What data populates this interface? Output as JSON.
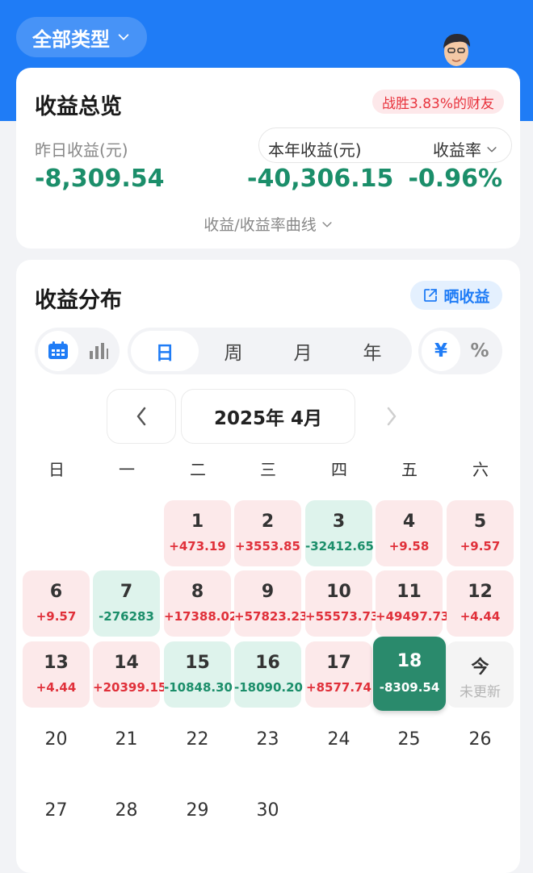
{
  "header": {
    "type_filter_label": "全部类型"
  },
  "overview": {
    "title": "收益总览",
    "beat_badge": "战胜3.83%的财友",
    "yesterday_label": "昨日收益(元)",
    "yesterday_value": "-8,309.54",
    "year_label": "本年收益(元)",
    "year_value": "-40,306.15",
    "rate_label": "收益率",
    "rate_value": "-0.96%",
    "curve_link": "收益/收益率曲线"
  },
  "distribution": {
    "title": "收益分布",
    "share_label": "晒收益",
    "period_tabs": [
      "日",
      "周",
      "月",
      "年"
    ],
    "active_period": 0,
    "unit_tabs": [
      "¥",
      "%"
    ],
    "active_unit": 0,
    "month_label": "2025年 4月",
    "weekdays": [
      "日",
      "一",
      "二",
      "三",
      "四",
      "五",
      "六"
    ],
    "days": [
      {
        "day": "1",
        "value": "+473.19",
        "state": "pos"
      },
      {
        "day": "2",
        "value": "+3553.85",
        "state": "pos"
      },
      {
        "day": "3",
        "value": "-32412.65",
        "state": "neg"
      },
      {
        "day": "4",
        "value": "+9.58",
        "state": "pos"
      },
      {
        "day": "5",
        "value": "+9.57",
        "state": "pos"
      },
      {
        "day": "6",
        "value": "+9.57",
        "state": "pos"
      },
      {
        "day": "7",
        "value": "-276283",
        "state": "neg"
      },
      {
        "day": "8",
        "value": "+17388.02",
        "state": "pos"
      },
      {
        "day": "9",
        "value": "+57823.23",
        "state": "pos"
      },
      {
        "day": "10",
        "value": "+55573.73",
        "state": "pos"
      },
      {
        "day": "11",
        "value": "+49497.73",
        "state": "pos"
      },
      {
        "day": "12",
        "value": "+4.44",
        "state": "pos"
      },
      {
        "day": "13",
        "value": "+4.44",
        "state": "pos"
      },
      {
        "day": "14",
        "value": "+20399.15",
        "state": "pos"
      },
      {
        "day": "15",
        "value": "-10848.30",
        "state": "neg"
      },
      {
        "day": "16",
        "value": "-18090.20",
        "state": "neg"
      },
      {
        "day": "17",
        "value": "+8577.74",
        "state": "pos"
      },
      {
        "day": "18",
        "value": "-8309.54",
        "state": "sel"
      },
      {
        "day": "今",
        "value": "未更新",
        "state": "today"
      },
      {
        "day": "20",
        "value": "",
        "state": "empty"
      },
      {
        "day": "21",
        "value": "",
        "state": "empty"
      },
      {
        "day": "22",
        "value": "",
        "state": "empty"
      },
      {
        "day": "23",
        "value": "",
        "state": "empty"
      },
      {
        "day": "24",
        "value": "",
        "state": "empty"
      },
      {
        "day": "25",
        "value": "",
        "state": "empty"
      },
      {
        "day": "26",
        "value": "",
        "state": "empty"
      },
      {
        "day": "27",
        "value": "",
        "state": "empty"
      },
      {
        "day": "28",
        "value": "",
        "state": "empty"
      },
      {
        "day": "29",
        "value": "",
        "state": "empty"
      },
      {
        "day": "30",
        "value": "",
        "state": "empty"
      }
    ]
  },
  "icons": {
    "type_filter": "chevron-down-icon",
    "share": "share-external-icon",
    "calendar_view": "calendar-icon",
    "chart_view": "bar-chart-icon",
    "prev_month": "chevron-left-icon",
    "next_month": "chevron-right-icon"
  },
  "colors": {
    "brand_blue": "#1f7cf6",
    "gain_red": "#e0303a",
    "loss_green": "#1b8e6a",
    "selected_day": "#2a8a6c"
  }
}
